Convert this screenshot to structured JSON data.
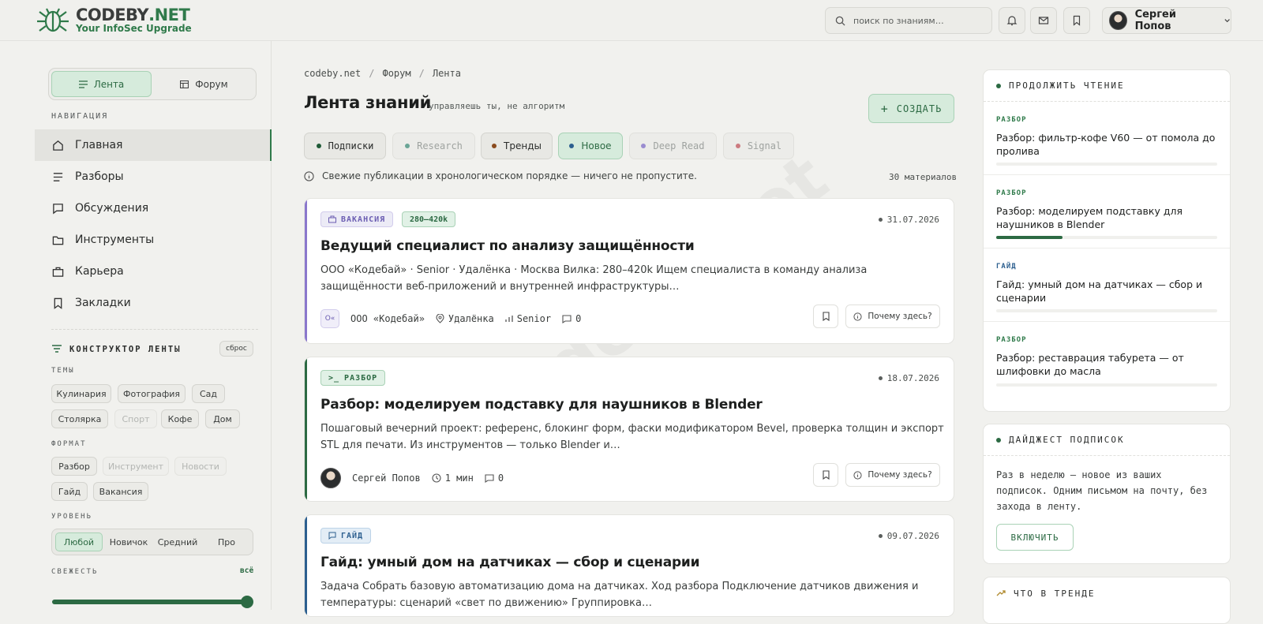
{
  "header": {
    "logo_name": "CODEBY",
    "logo_suffix": ".NET",
    "logo_tagline": "Your InfoSec Upgrade",
    "search_placeholder": "поиск по знаниям…",
    "user_name": "Сергей Попов"
  },
  "left": {
    "toggle": {
      "feed": "Лента",
      "forum": "Форум"
    },
    "nav_title": "НАВИГАЦИЯ",
    "nav": [
      {
        "label": "Главная",
        "icon": "home-icon"
      },
      {
        "label": "Разборы",
        "icon": "lines-icon"
      },
      {
        "label": "Обсуждения",
        "icon": "chat-icon"
      },
      {
        "label": "Инструменты",
        "icon": "folder-icon"
      },
      {
        "label": "Карьера",
        "icon": "briefcase-icon"
      },
      {
        "label": "Закладки",
        "icon": "bookmark-icon"
      }
    ],
    "builder_title": "КОНСТРУКТОР ЛЕНТЫ",
    "reset": "сброс",
    "topics_title": "ТЕМЫ",
    "topics": [
      "Кулинария",
      "Фотография",
      "Сад",
      "Столярка",
      "Спорт",
      "Кофе",
      "Дом"
    ],
    "format_title": "ФОРМАТ",
    "formats": [
      "Разбор",
      "Инструмент",
      "Новости",
      "Гайд",
      "Вакансия"
    ],
    "level_title": "УРОВЕНЬ",
    "levels": [
      "Любой",
      "Новичок",
      "Средний",
      "Про"
    ],
    "fresh_title": "СВЕЖЕСТЬ",
    "fresh_value": "всё"
  },
  "main": {
    "breadcrumb": [
      "codeby.net",
      "/",
      "Форум",
      "/",
      "Лента"
    ],
    "title": "Лента знаний",
    "subtitle": "управляешь ты, не алгоритм",
    "create": "СОЗДАТЬ",
    "tabs": [
      {
        "label": "Подписки",
        "color": "#1f5a37"
      },
      {
        "label": "Research",
        "color": "#6aa596"
      },
      {
        "label": "Тренды",
        "color": "#8a4b1e"
      },
      {
        "label": "Новое",
        "color": "#2c5f8f"
      },
      {
        "label": "Deep Read",
        "color": "#9a8cd0"
      },
      {
        "label": "Signal",
        "color": "#cc7b80"
      }
    ],
    "info": "Свежие публикации в хронологическом порядке — ничего не пропустите.",
    "count": "30 материалов",
    "cards": [
      {
        "badge": "ВАКАНСИЯ",
        "salary": "280–420k",
        "date": "31.07.2026",
        "title": "Ведущий специалист по анализу защищённости",
        "desc": "ООО «Кодебай» · Senior · Удалёнка · Москва Вилка: 280–420k Ищем специалиста в команду анализа защищённости веб-приложений и внутренней инфраструктуры…",
        "logo": "О«",
        "company": "ООО «Кодебай»",
        "location": "Удалёнка",
        "level": "Senior",
        "comments": "0",
        "why": "Почему здесь?"
      },
      {
        "badge": "РАЗБОР",
        "date": "18.07.2026",
        "title": "Разбор: моделируем подставку для наушников в Blender",
        "desc": "Пошаговый вечерний проект: референс, блокинг форм, фаски модификатором Bevel, проверка толщин и экспорт STL для печати. Из инструментов — только Blender и…",
        "author": "Сергей Попов",
        "read": "1 мин",
        "comments": "0",
        "why": "Почему здесь?"
      },
      {
        "badge": "ГАЙД",
        "date": "09.07.2026",
        "title": "Гайд: умный дом на датчиках — сбор и сценарии",
        "desc": "Задача Собрать базовую автоматизацию дома на датчиках. Ход разбора Подключение датчиков движения и температуры: сценарий «свет по движению» Группировка…"
      }
    ],
    "watermark": "codeby.net"
  },
  "right": {
    "continue_title": "ПРОДОЛЖИТЬ ЧТЕНИЕ",
    "continue": [
      {
        "tag": "РАЗБОР",
        "title": "Разбор: фильтр-кофе V60 — от помола до пролива",
        "progress": 0
      },
      {
        "tag": "РАЗБОР",
        "title": "Разбор: моделируем подставку для наушников в Blender",
        "progress": 0.3
      },
      {
        "tag": "ГАЙД",
        "title": "Гайд: умный дом на датчиках — сбор и сценарии",
        "progress": 0
      },
      {
        "tag": "РАЗБОР",
        "title": "Разбор: реставрация табурета — от шлифовки до масла",
        "progress": 0
      }
    ],
    "digest_title": "ДАЙДЖЕСТ ПОДПИСОК",
    "digest_text": "Раз в неделю — новое из ваших подписок. Одним письмом на почту, без захода в ленту.",
    "digest_button": "ВКЛЮЧИТЬ",
    "trend_title": "ЧТО В ТРЕНДЕ"
  }
}
